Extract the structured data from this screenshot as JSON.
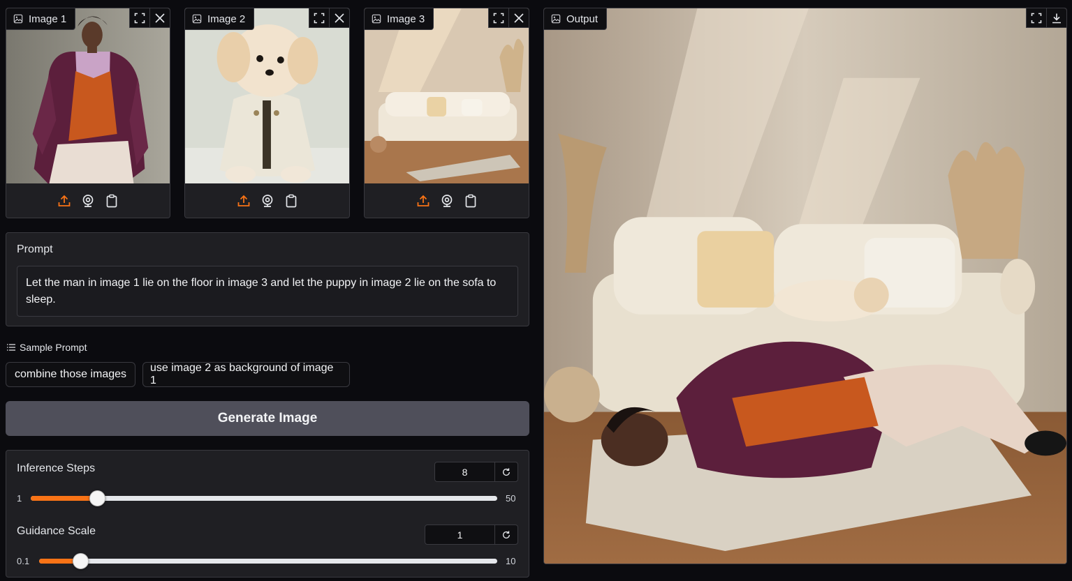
{
  "inputs": [
    {
      "label": "Image 1",
      "subject": "man"
    },
    {
      "label": "Image 2",
      "subject": "puppy"
    },
    {
      "label": "Image 3",
      "subject": "sofa-room"
    }
  ],
  "output": {
    "label": "Output"
  },
  "prompt": {
    "label": "Prompt",
    "value": "Let the man in image 1 lie on the floor in image 3 and let the puppy in image 2 lie on the sofa to sleep."
  },
  "samples": {
    "title": "Sample Prompt",
    "items": [
      "combine those images",
      "use image 2 as background of image 1"
    ]
  },
  "generate_label": "Generate Image",
  "sliders": {
    "steps": {
      "label": "Inference Steps",
      "value": "8",
      "min": "1",
      "max": "50",
      "fraction": 0.143
    },
    "guidance": {
      "label": "Guidance Scale",
      "value": "1",
      "min": "0.1",
      "max": "10",
      "fraction": 0.091
    }
  },
  "colors": {
    "accent": "#f97316",
    "background": "#0b0b0f",
    "panel": "#1f1f23",
    "button": "#4f4f5a"
  },
  "icons": [
    "image-icon",
    "fullscreen-icon",
    "close-icon",
    "upload-icon",
    "webcam-icon",
    "clipboard-icon",
    "download-icon",
    "list-icon",
    "reset-icon"
  ]
}
